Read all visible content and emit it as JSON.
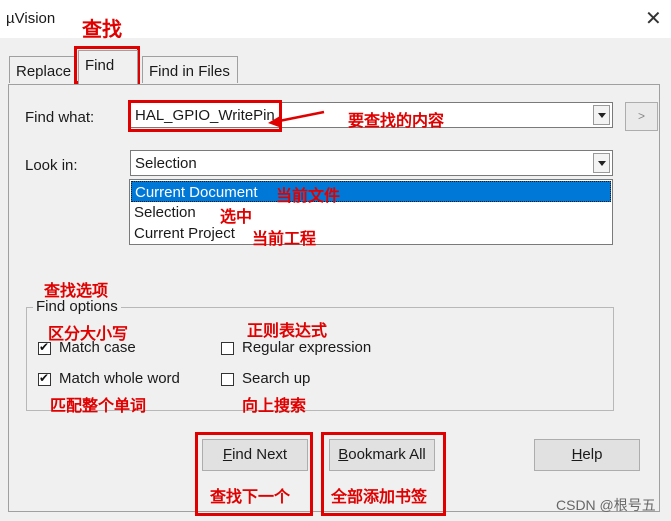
{
  "window": {
    "title": "µVision",
    "close_glyph": "✕"
  },
  "tabs": [
    {
      "label": "Replace"
    },
    {
      "label": "Find"
    },
    {
      "label": "Find in Files"
    }
  ],
  "find_what": {
    "label": "Find what:",
    "value": "HAL_GPIO_WritePin"
  },
  "look_in": {
    "label": "Look in:",
    "value": "Selection",
    "options": [
      "Current Document",
      "Selection",
      "Current Project"
    ],
    "selected_index": 0
  },
  "more_button": {
    "label": ">"
  },
  "find_options": {
    "legend": "Find options",
    "match_case": {
      "label": "Match case",
      "checked": true
    },
    "match_whole_word": {
      "label": "Match whole word",
      "checked": true
    },
    "regular_expression": {
      "label": "Regular expression",
      "checked": false
    },
    "search_up": {
      "label": "Search up",
      "checked": false
    }
  },
  "buttons": {
    "find_next_pre": "",
    "find_next_u": "F",
    "find_next_post": "ind Next",
    "bookmark_all_pre": "",
    "bookmark_all_u": "B",
    "bookmark_all_post": "ookmark All",
    "help_pre": "",
    "help_u": "H",
    "help_post": "elp"
  },
  "annotations": {
    "find_tab": "查找",
    "find_content": "要查找的内容",
    "current_document": "当前文件",
    "selection": "选中",
    "current_project": "当前工程",
    "find_options": "查找选项",
    "match_case": "区分大小写",
    "regular_expression": "正则表达式",
    "match_whole_word": "匹配整个单词",
    "search_up": "向上搜索",
    "find_next": "查找下一个",
    "bookmark_all": "全部添加书签"
  },
  "watermark": "CSDN @根号五",
  "colors": {
    "annotation": "#e00000",
    "selection_highlight": "#0078d7"
  }
}
